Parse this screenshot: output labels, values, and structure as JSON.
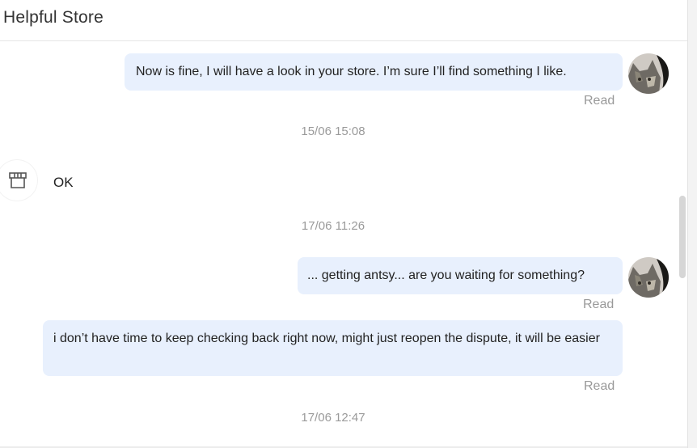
{
  "header": {
    "title": "Helpful Store"
  },
  "messages": [
    {
      "side": "right",
      "text": "Now is fine, I will have a look in your store. I’m sure I’ll find something I like.",
      "status": "Read"
    },
    {
      "side": "left",
      "text": "OK"
    },
    {
      "side": "right",
      "text": "... getting antsy... are you waiting for something?",
      "status": "Read"
    },
    {
      "side": "right",
      "text": "i don’t have time to keep checking back right now, might just reopen the dispute, it will be easier",
      "status": "Read"
    }
  ],
  "timestamps": [
    "15/06 15:08",
    "17/06 11:26",
    "17/06 12:47"
  ],
  "icons": {
    "user_avatar": "cat-avatar-icon",
    "store_avatar": "store-awning-icon"
  },
  "colors": {
    "bubble": "#e8f0fd",
    "muted_text": "#999999"
  }
}
